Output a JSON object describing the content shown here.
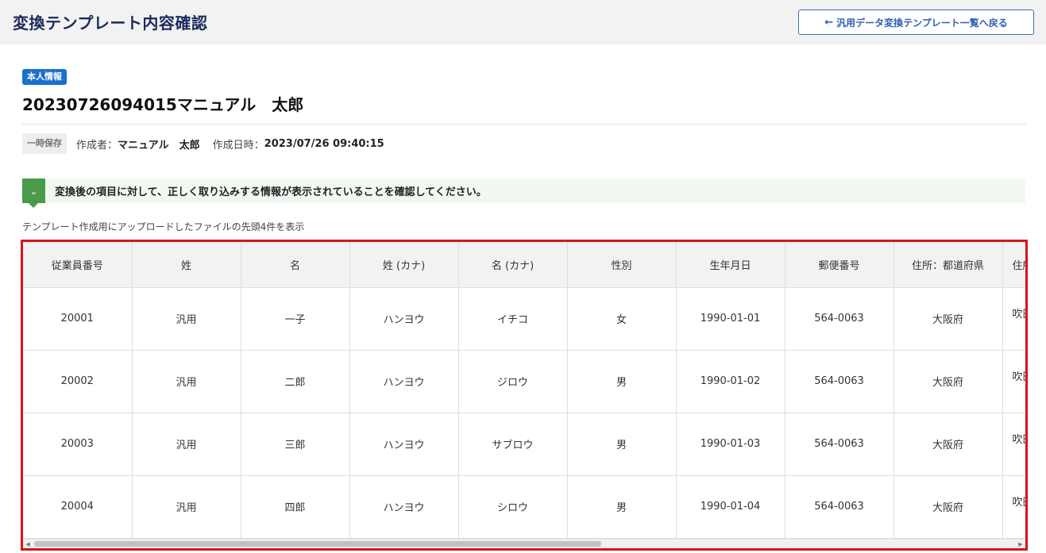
{
  "header": {
    "title": "変換テンプレート内容確認",
    "back_button_label": "汎用データ変換テンプレート一覧へ戻る",
    "back_icon": "arrow-left-icon"
  },
  "record": {
    "badge": "本人情報",
    "title": "20230726094015マニュアル　太郎",
    "status": "一時保存",
    "creator_label": "作成者：",
    "creator": "マニュアル　太郎",
    "created_at_label": "作成日時：",
    "created_at": "2023/07/26 09:40:15"
  },
  "notice": {
    "icon": "chevron-down-icon",
    "text": "変換後の項目に対して、正しく取り込みする情報が表示されていることを確認してください。"
  },
  "table": {
    "caption": "テンプレート作成用にアップロードしたファイルの先頭4件を表示",
    "columns": [
      "従業員番号",
      "姓",
      "名",
      "姓 (カナ)",
      "名 (カナ)",
      "性別",
      "生年月日",
      "郵便番号",
      "住所：都道府県",
      "住所"
    ],
    "rows": [
      [
        "20001",
        "汎用",
        "一子",
        "ハンヨウ",
        "イチコ",
        "女",
        "1990-01-01",
        "564-0063",
        "大阪府",
        "吹田"
      ],
      [
        "20002",
        "汎用",
        "二郎",
        "ハンヨウ",
        "ジロウ",
        "男",
        "1990-01-02",
        "564-0063",
        "大阪府",
        "吹田"
      ],
      [
        "20003",
        "汎用",
        "三郎",
        "ハンヨウ",
        "サブロウ",
        "男",
        "1990-01-03",
        "564-0063",
        "大阪府",
        "吹田"
      ],
      [
        "20004",
        "汎用",
        "四郎",
        "ハンヨウ",
        "シロウ",
        "男",
        "1990-01-04",
        "564-0063",
        "大阪府",
        "吹田"
      ]
    ],
    "highlight_color": "#d7151a"
  },
  "colors": {
    "title": "#1b2a5c",
    "badge": "#1a6fd0",
    "notice_icon": "#4a9a4a",
    "notice_bg": "#f1f8f1",
    "button_border": "#3d6fc2"
  }
}
